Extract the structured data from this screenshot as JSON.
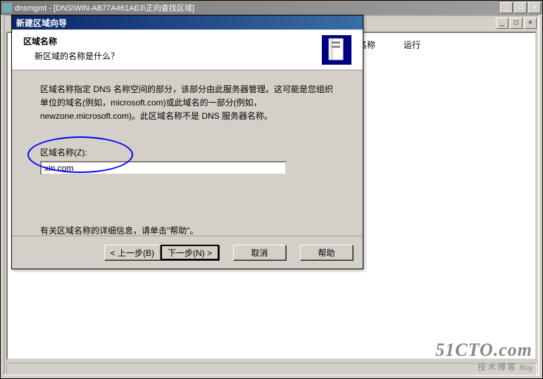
{
  "mmc": {
    "title": "dnsmgmt - [DNS\\WIN-AB77A461AE3\\正向查找区域]",
    "content": {
      "name_col": "名称",
      "hint": "运行"
    }
  },
  "wizard": {
    "title": "新建区域向导",
    "header_title": "区域名称",
    "header_subtitle": "新区域的名称是什么？",
    "body_text": "区域名称指定 DNS 名称空间的部分，该部分由此服务器管理。这可能是您组织单位的域名(例如，microsoft.com)或此域名的一部分(例如，newzone.microsoft.com)。此区域名称不是 DNS 服务器名称。",
    "field_label": "区域名称(Z):",
    "field_value": "xin.com",
    "help_text": "有关区域名称的详细信息，请单击\"帮助\"。",
    "buttons": {
      "back": "< 上一步(B)",
      "next": "下一步(N) >",
      "cancel": "取消",
      "help": "帮助"
    }
  },
  "win_controls": {
    "min": "_",
    "max": "□",
    "close": "×"
  },
  "watermark": {
    "line1": "51CTO.com",
    "line2": "技术博客",
    "line3": "Blog"
  }
}
